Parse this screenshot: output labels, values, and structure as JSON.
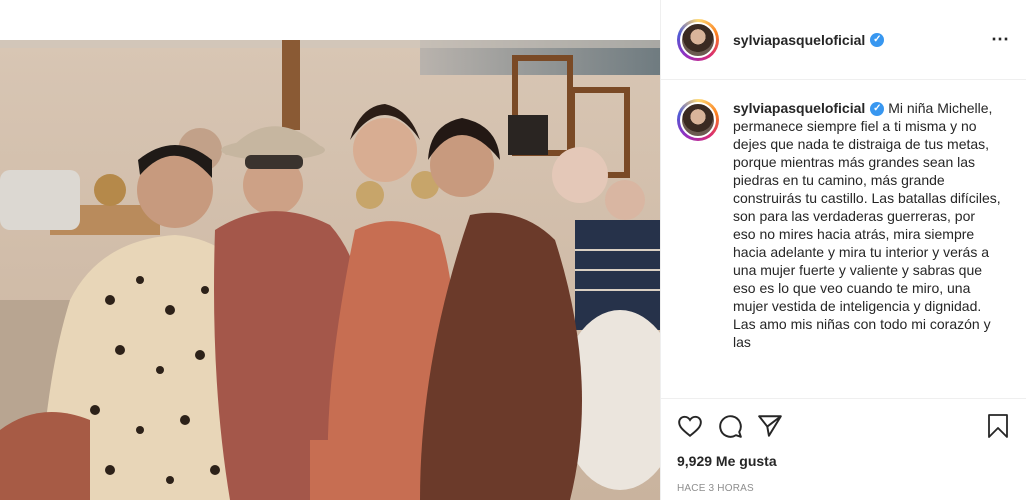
{
  "post": {
    "username": "sylviapasqueloficial",
    "verified_icon": "verified-badge-icon",
    "more_icon": "more-options-icon"
  },
  "caption": {
    "username": "sylviapasqueloficial",
    "text": "Mi niña Michelle, permanece siempre fiel a ti misma y no dejes que nada te distraiga de tus metas, porque mientras más grandes sean las piedras en tu camino, más grande construirás tu castillo. Las batallas difíciles, son para las verdaderas guerreras, por eso no mires hacia atrás, mira siempre hacia adelante y mira tu interior y verás a una mujer fuerte y valiente y sabras que eso es lo que veo cuando te miro, una mujer vestida de inteligencia y dignidad. Las amo mis niñas con todo mi corazón y las"
  },
  "actions": {
    "like_icon": "heart-icon",
    "comment_icon": "comment-icon",
    "share_icon": "share-icon",
    "save_icon": "bookmark-icon"
  },
  "likes": "9,929 Me gusta",
  "time": "HACE 3 HORAS",
  "colors": {
    "verified": "#3897f0",
    "text": "#262626",
    "muted": "#8e8e8e",
    "border": "#efefef"
  }
}
